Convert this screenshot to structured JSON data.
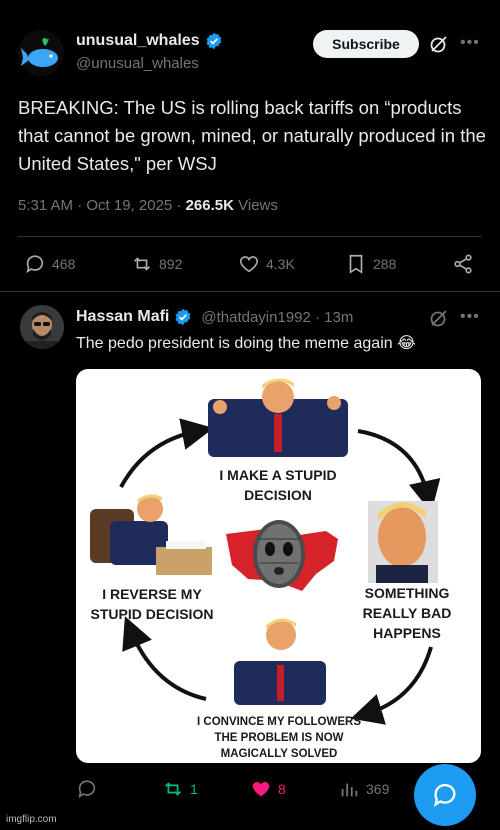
{
  "post": {
    "author_name": "unusual_whales",
    "author_handle": "@unusual_whales",
    "subscribe_label": "Subscribe",
    "text": "BREAKING: The US is rolling back tariffs on “products that cannot be grown, mined, or naturally produced in the United States,\" per WSJ",
    "timestamp": "5:31 AM · Oct 19, 2025 · ",
    "views_count": "266.5K",
    "views_label": " Views",
    "actions": {
      "replies": "468",
      "reposts": "892",
      "likes": "4.3K",
      "bookmarks": "288"
    }
  },
  "reply": {
    "author_name": "Hassan Mafi",
    "author_handle": "@thatdayin1992 · 13m",
    "text": "The pedo president is doing the meme again 😂",
    "meme": {
      "label_top": "I MAKE A STUPID DECISION",
      "label_right": "SOMETHING REALLY BAD HAPPENS",
      "label_bottom": "I CONVINCE MY FOLLOWERS THE PROBLEM IS NOW MAGICALLY SOLVED",
      "label_left": "I REVERSE MY STUPID DECISION"
    },
    "actions": {
      "reposts": "1",
      "likes": "8",
      "views": "369"
    }
  },
  "colors": {
    "accent": "#1d9bf0",
    "repost_active": "#00ba7c",
    "like_active": "#f91880",
    "muted": "#71767b"
  },
  "watermark": "imgflip.com"
}
